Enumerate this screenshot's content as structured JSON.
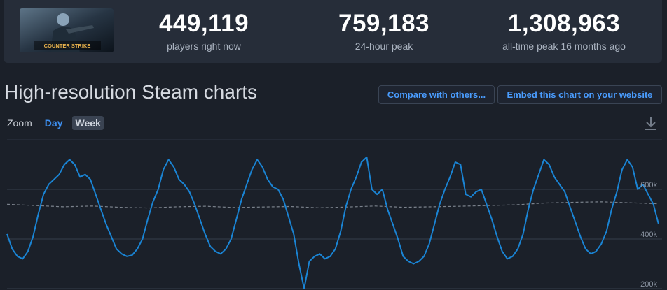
{
  "header": {
    "thumbnail_text": "COUNTER STRIKE",
    "stats": [
      {
        "value": "449,119",
        "label": "players right now"
      },
      {
        "value": "759,183",
        "label": "24-hour peak"
      },
      {
        "value": "1,308,963",
        "label": "all-time peak 16 months ago"
      }
    ]
  },
  "chart_section": {
    "title": "High-resolution Steam charts",
    "compare_label": "Compare with others...",
    "embed_label": "Embed this chart on your website",
    "zoom_label": "Zoom",
    "zoom_day": "Day",
    "zoom_week": "Week",
    "download_icon": "download-icon"
  },
  "colors": {
    "background": "#1b2029",
    "card": "#262d39",
    "accent": "#3d8ff0",
    "series_line": "#1a84d4",
    "average_line": "#7b828c"
  },
  "chart_data": {
    "type": "line",
    "y_ticks": [
      {
        "value": 200000,
        "label": "200k"
      },
      {
        "value": 400000,
        "label": "400k"
      },
      {
        "value": 600000,
        "label": "600k"
      }
    ],
    "grid": true,
    "series": [
      {
        "values": [
          420000,
          360000,
          330000,
          320000,
          350000,
          410000,
          500000,
          580000,
          620000,
          640000,
          660000,
          700000,
          720000,
          700000,
          650000,
          660000,
          640000,
          580000,
          520000,
          460000,
          410000,
          360000,
          340000,
          330000,
          335000,
          360000,
          400000,
          480000,
          550000,
          600000,
          680000,
          720000,
          690000,
          640000,
          620000,
          590000,
          540000,
          480000,
          420000,
          370000,
          350000,
          340000,
          360000,
          400000,
          480000,
          560000,
          620000,
          680000,
          720000,
          690000,
          640000,
          610000,
          600000,
          560000,
          490000,
          420000,
          300000,
          200000,
          310000,
          330000,
          340000,
          320000,
          330000,
          360000,
          430000,
          530000,
          600000,
          650000,
          710000,
          730000,
          600000,
          580000,
          600000,
          520000,
          460000,
          400000,
          330000,
          310000,
          300000,
          310000,
          330000,
          380000,
          460000,
          540000,
          600000,
          650000,
          710000,
          700000,
          580000,
          570000,
          590000,
          600000,
          540000,
          480000,
          410000,
          350000,
          320000,
          330000,
          360000,
          420000,
          520000,
          600000,
          660000,
          720000,
          700000,
          650000,
          620000,
          590000,
          530000,
          470000,
          410000,
          360000,
          340000,
          350000,
          380000,
          430000,
          520000,
          590000,
          680000,
          720000,
          690000,
          600000,
          620000,
          580000,
          540000,
          460000
        ],
        "average": [
          540000,
          535000,
          530000,
          533000,
          528000,
          525000,
          530000,
          532000,
          527000,
          529000,
          531000,
          526000,
          529000,
          533000,
          528000,
          530000,
          532000,
          535000,
          538000,
          545000,
          548000,
          550000,
          546000,
          542000
        ]
      }
    ]
  }
}
